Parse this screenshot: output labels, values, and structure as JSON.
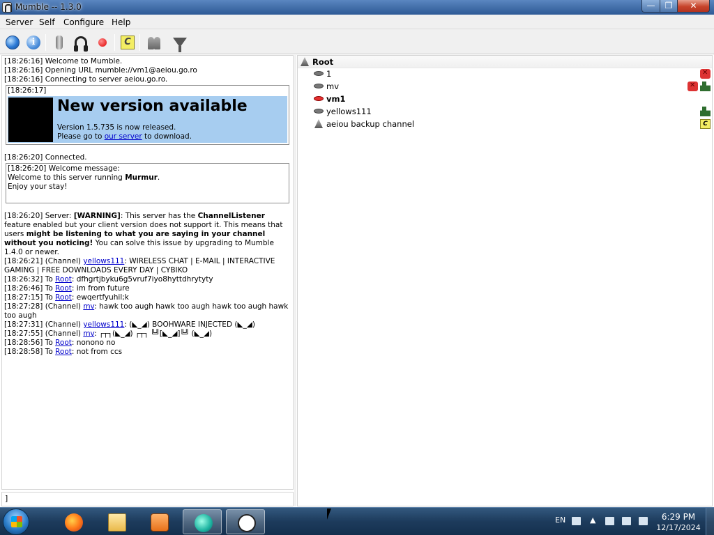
{
  "window": {
    "title": "Mumble -- 1.3.0",
    "min": "—",
    "max": "❐",
    "close": "✕"
  },
  "menu": [
    "Server",
    "Self",
    "Configure",
    "Help"
  ],
  "toolbar": [
    "globe-icon",
    "info-icon",
    "microphone-icon",
    "headphones-icon",
    "record-icon",
    "comment-icon",
    "users-icon",
    "filter-icon"
  ],
  "log": {
    "l1": "[18:26:16] Welcome to Mumble.",
    "l2": "[18:26:16] Opening URL mumble://vm1@aeiou.go.ro",
    "l3": "[18:26:16] Connecting to server aeiou.go.ro.",
    "box1_time": "[18:26:17]",
    "newver_title": "New version available",
    "newver_line1": "Version 1.5.735 is now released.",
    "newver_pre": "Please go to ",
    "newver_link": "our server",
    "newver_post": " to download.",
    "connected": "[18:26:20] Connected.",
    "box2_time": "[18:26:20] Welcome message:",
    "welcome_pre": "Welcome to this server running ",
    "welcome_bold": "Murmur",
    "welcome_post": ".",
    "welcome_2": "Enjoy your stay!",
    "warn_pre": "[18:26:20] Server: ",
    "warn_tag": "[WARNING]",
    "warn_a": ": This server has the ",
    "warn_feature": "ChannelListener",
    "warn_b": " feature enabled but your client version does not support it. This means that users ",
    "warn_bold": "might be listening to what you are saying in your channel without you noticing!",
    "warn_c": " You can solve this issue by upgrading to Mumble 1.4.0 or newer.",
    "m1_pre": "[18:26:21] (Channel) ",
    "m1_user": "yellows111",
    "m1_text": ": WIRELESS CHAT | E-MAIL | INTERACTIVE GAMING | FREE DOWNLOADS EVERY DAY | CYBIKO",
    "m2_pre": "[18:26:32] To ",
    "m2_user": "Root",
    "m2_text": ": dfhgrtjbyku6g5vruf7iyo8hyttdhrytyty",
    "m3_pre": "[18:26:46] To ",
    "m3_user": "Root",
    "m3_text": ": im from future",
    "m4_pre": "[18:27:15] To ",
    "m4_user": "Root",
    "m4_text": ": ewqertfyuhil;k",
    "m5_pre": "[18:27:28] (Channel) ",
    "m5_user": "mv",
    "m5_text": ": hawk too augh hawk too augh hawk too augh hawk too augh",
    "m6_pre": "[18:27:31] (Channel) ",
    "m6_user": "yellows111",
    "m6_text": ": (◣_◢) BOOHWARE INJECTED (◣_◢)",
    "m7_pre": "[18:27:55] (Channel) ",
    "m7_user": "mv",
    "m7_text": ":  ┌┬┐(◣_◢) ┌┬┐ ╚╝[◣_◢]╚╝ (◣_◢)",
    "m8_pre": "[18:28:56] To ",
    "m8_user": "Root",
    "m8_text": ": nonono no",
    "m9_pre": "[18:28:58] To ",
    "m9_user": "Root",
    "m9_text": ": not from ccs"
  },
  "input": {
    "value": "]"
  },
  "tree": {
    "root": "Root",
    "users": [
      {
        "name": "1",
        "bold": false,
        "talking": false,
        "flags": [
          "deafened-icon"
        ]
      },
      {
        "name": "mv",
        "bold": false,
        "talking": false,
        "flags": [
          "deafened-icon",
          "registered-icon"
        ]
      },
      {
        "name": "vm1",
        "bold": true,
        "talking": true,
        "flags": []
      },
      {
        "name": "yellows111",
        "bold": false,
        "talking": false,
        "flags": [
          "registered-icon"
        ]
      }
    ],
    "channel": "aeiou backup channel",
    "channel_flag": "C"
  },
  "taskbar": {
    "apps": [
      "firefox-icon",
      "folder-icon",
      "media-player-icon",
      "wave-app-icon",
      "mumble-icon"
    ],
    "lang": "EN",
    "time": "6:29 PM",
    "date": "12/17/2024"
  }
}
